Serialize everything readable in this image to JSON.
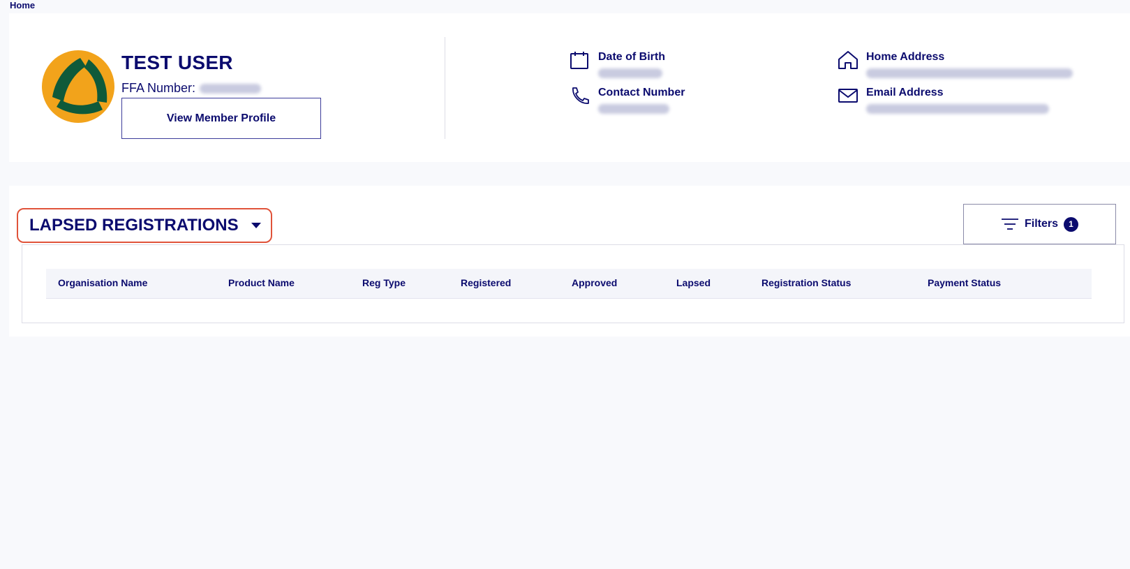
{
  "breadcrumb": {
    "home": "Home"
  },
  "profile": {
    "name": "TEST USER",
    "ffa_label": "FFA Number:",
    "view_button": "View Member Profile",
    "fields": {
      "dob_label": "Date of Birth",
      "contact_label": "Contact Number",
      "address_label": "Home Address",
      "email_label": "Email Address"
    }
  },
  "registrations": {
    "title": "LAPSED REGISTRATIONS",
    "filters_label": "Filters",
    "filters_count": "1",
    "columns": [
      "Organisation Name",
      "Product Name",
      "Reg Type",
      "Registered",
      "Approved",
      "Lapsed",
      "Registration Status",
      "Payment Status"
    ]
  },
  "colors": {
    "navy": "#0b0b6e",
    "logo_green": "#0f5a3a",
    "logo_gold": "#f2a31b",
    "highlight": "#e0533a"
  },
  "icons": [
    "calendar-icon",
    "phone-icon",
    "home-icon",
    "mail-icon",
    "filter-icon",
    "caret-down-icon"
  ]
}
